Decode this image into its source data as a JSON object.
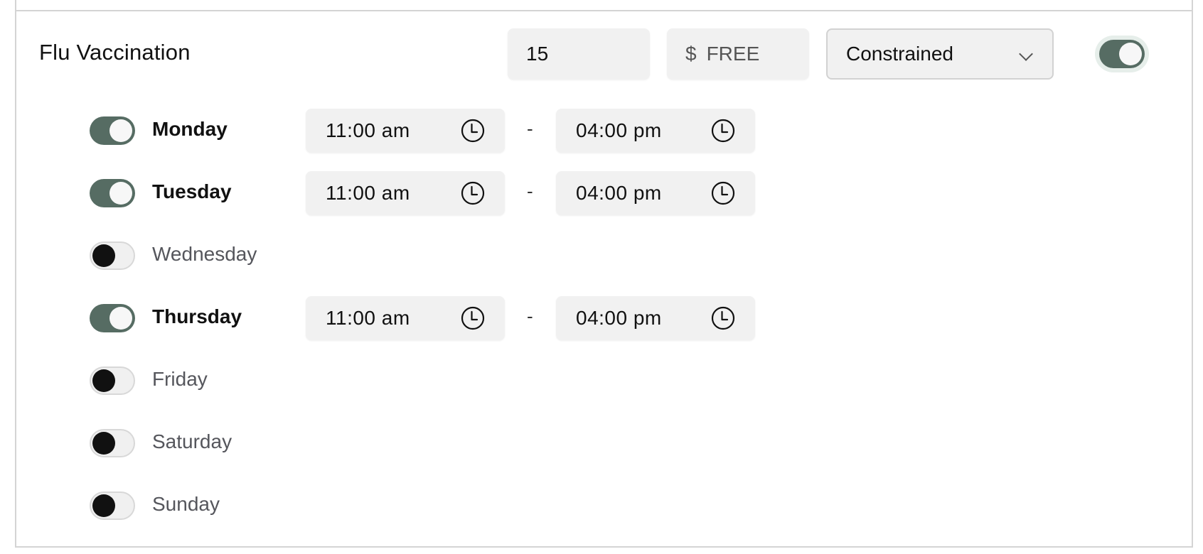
{
  "service": {
    "title": "Flu Vaccination",
    "quantity_value": "15",
    "price_currency": "$",
    "price_value": "FREE",
    "mode_selected": "Constrained",
    "enabled": true
  },
  "schedule": [
    {
      "day": "Monday",
      "enabled": true,
      "start": "11:00 am",
      "end": "04:00 pm"
    },
    {
      "day": "Tuesday",
      "enabled": true,
      "start": "11:00 am",
      "end": "04:00 pm"
    },
    {
      "day": "Wednesday",
      "enabled": false
    },
    {
      "day": "Thursday",
      "enabled": true,
      "start": "11:00 am",
      "end": "04:00 pm"
    },
    {
      "day": "Friday",
      "enabled": false
    },
    {
      "day": "Saturday",
      "enabled": false
    },
    {
      "day": "Sunday",
      "enabled": false
    }
  ],
  "separator": "-",
  "icons": {
    "time": "clock-icon",
    "dropdown": "chevron-down-icon"
  },
  "colors": {
    "toggle_on": "#566c63",
    "toggle_off_knob": "#111111",
    "field_bg": "#f1f1f1",
    "border": "#d4d4d4"
  }
}
